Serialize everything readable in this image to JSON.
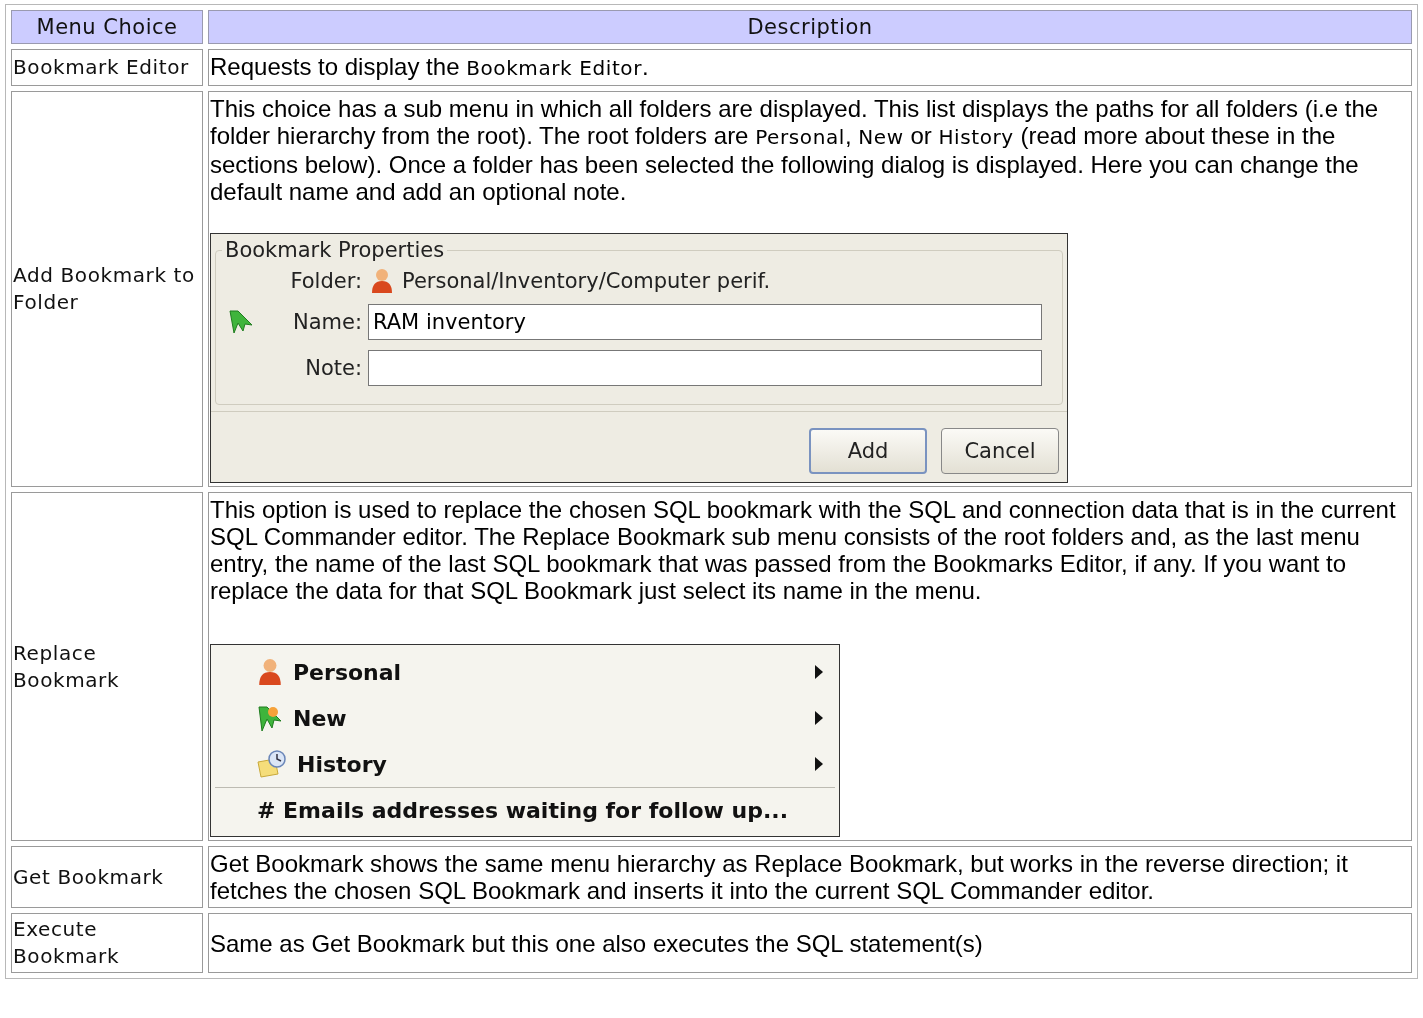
{
  "table": {
    "columns": [
      "Menu Choice",
      "Description"
    ],
    "rows": [
      {
        "choice": "Bookmark Editor",
        "description": [
          {
            "kind": "plain",
            "text": "Requests to display the "
          },
          {
            "kind": "term",
            "text": "Bookmark Editor"
          },
          {
            "kind": "plain",
            "text": "."
          }
        ]
      },
      {
        "choice": "Add Bookmark to Folder",
        "description": [
          {
            "kind": "plain",
            "text": "This choice has a sub menu in which all folders are displayed. This list displays the paths for all folders (i.e the folder hierarchy from the root). The root folders are "
          },
          {
            "kind": "term",
            "text": "Personal"
          },
          {
            "kind": "plain",
            "text": ", "
          },
          {
            "kind": "term",
            "text": "New"
          },
          {
            "kind": "plain",
            "text": " or "
          },
          {
            "kind": "term",
            "text": "History"
          },
          {
            "kind": "plain",
            "text": " (read more about these in the sections below). Once a folder has been selected the following dialog is displayed. Here you can change the default name and add an optional note."
          }
        ],
        "figure": {
          "kind": "dialog",
          "legend": "Bookmark Properties",
          "fields": [
            {
              "kind": "path",
              "label": "Folder:",
              "value": "Personal/Inventory/Computer perif."
            },
            {
              "kind": "input",
              "label": "Name:",
              "value": "RAM inventory"
            },
            {
              "kind": "input",
              "label": "Note:"
            }
          ],
          "buttons": [
            {
              "label": "Add",
              "default": true
            },
            {
              "label": "Cancel",
              "default": false
            }
          ]
        }
      },
      {
        "choice": "Replace Bookmark",
        "description": [
          {
            "kind": "plain",
            "text": "This option is used to replace the chosen SQL bookmark with the SQL and connection data that is in the current SQL Commander editor. The Replace Bookmark sub menu consists of the root folders and, as the last menu entry, the name of the last SQL bookmark that was passed from the Bookmarks Editor, if any. If you want to replace the data for that SQL Bookmark just select its name in the menu."
          }
        ],
        "figure": {
          "kind": "menu",
          "folders": [
            {
              "label": "Personal"
            },
            {
              "label": "New"
            },
            {
              "label": "History"
            }
          ],
          "bookmarks": [
            {
              "label": "# Emails addresses waiting for follow up..."
            }
          ]
        }
      },
      {
        "choice": "Get Bookmark",
        "description": [
          {
            "kind": "plain",
            "text": "Get Bookmark shows the same menu hierarchy as Replace Bookmark, but works in the reverse direction; it fetches the chosen SQL Bookmark and inserts it into the current SQL Commander editor."
          }
        ]
      },
      {
        "choice": "Execute Bookmark",
        "description": [
          {
            "kind": "plain",
            "text": "Same as Get Bookmark but this one also executes the SQL statement(s)"
          }
        ]
      }
    ]
  }
}
